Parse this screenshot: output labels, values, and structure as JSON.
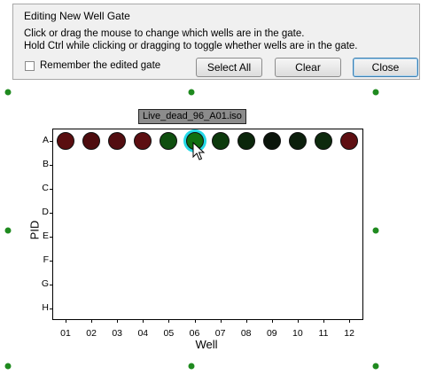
{
  "dialog": {
    "title": "Editing New Well Gate",
    "instruction_1": "Click or drag the mouse to change which wells are in the gate.",
    "instruction_2": "Hold Ctrl while clicking or dragging to toggle whether wells are in the gate.",
    "remember_label": "Remember the edited gate",
    "remember_checked": false,
    "select_all_label": "Select All",
    "clear_label": "Clear",
    "close_label": "Close"
  },
  "plot": {
    "tooltip": "Live_dead_96_A01.iso",
    "y_axis_title": "PID",
    "x_axis_title": "Well",
    "rows": [
      "A",
      "B",
      "C",
      "D",
      "E",
      "F",
      "G",
      "H"
    ],
    "columns": [
      "01",
      "02",
      "03",
      "04",
      "05",
      "06",
      "07",
      "08",
      "09",
      "10",
      "11",
      "12"
    ],
    "row_A_wells": [
      {
        "col": "01",
        "color": "#5a0e10"
      },
      {
        "col": "02",
        "color": "#4e0c0e"
      },
      {
        "col": "03",
        "color": "#520d10"
      },
      {
        "col": "04",
        "color": "#5c0e11"
      },
      {
        "col": "05",
        "color": "#0f4f0f"
      },
      {
        "col": "06",
        "color": "#107010",
        "selected": true
      },
      {
        "col": "07",
        "color": "#0d3a0d"
      },
      {
        "col": "08",
        "color": "#0b260b"
      },
      {
        "col": "09",
        "color": "#0a140a"
      },
      {
        "col": "10",
        "color": "#0c1f0c"
      },
      {
        "col": "11",
        "color": "#0d2a0d"
      },
      {
        "col": "12",
        "color": "#5e0f12"
      }
    ],
    "colors": {
      "hatch": "#3c9b3c",
      "handle": "#1f8a1f",
      "selection_ring": "#23d9e6"
    }
  }
}
